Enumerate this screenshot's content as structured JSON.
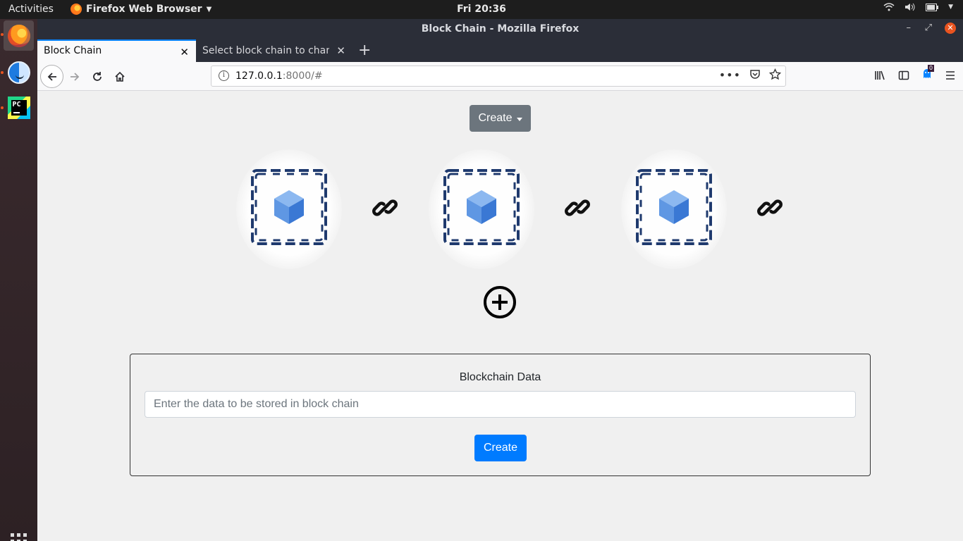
{
  "topbar": {
    "activities": "Activities",
    "app_name": "Firefox Web Browser",
    "clock": "Fri 20:36"
  },
  "dock": {
    "items": [
      "firefox-icon",
      "finder-icon",
      "pycharm-icon"
    ],
    "pycharm_text": "PC"
  },
  "window": {
    "title": "Block Chain - Mozilla Firefox"
  },
  "tabs": [
    {
      "label": "Block Chain",
      "active": true
    },
    {
      "label": "Select block chain to change",
      "active": false
    }
  ],
  "navbar": {
    "url_host": "127.0.0.1",
    "url_path": ":8000/#",
    "notification_badge": "0"
  },
  "page": {
    "dropdown_label": "Create",
    "blocks": [
      {
        "icon": "chained-block-icon"
      },
      {
        "icon": "chained-block-icon"
      },
      {
        "icon": "chained-block-icon"
      }
    ],
    "panel": {
      "title": "Blockchain Data",
      "input_placeholder": "Enter the data to be stored in block chain",
      "input_value": "",
      "submit_label": "Create"
    }
  },
  "colors": {
    "primary": "#007bff",
    "secondary": "#6c757d",
    "chain": "#1f3a6e",
    "cube_light": "#6fa4e8",
    "cube_dark": "#3a78d4"
  }
}
